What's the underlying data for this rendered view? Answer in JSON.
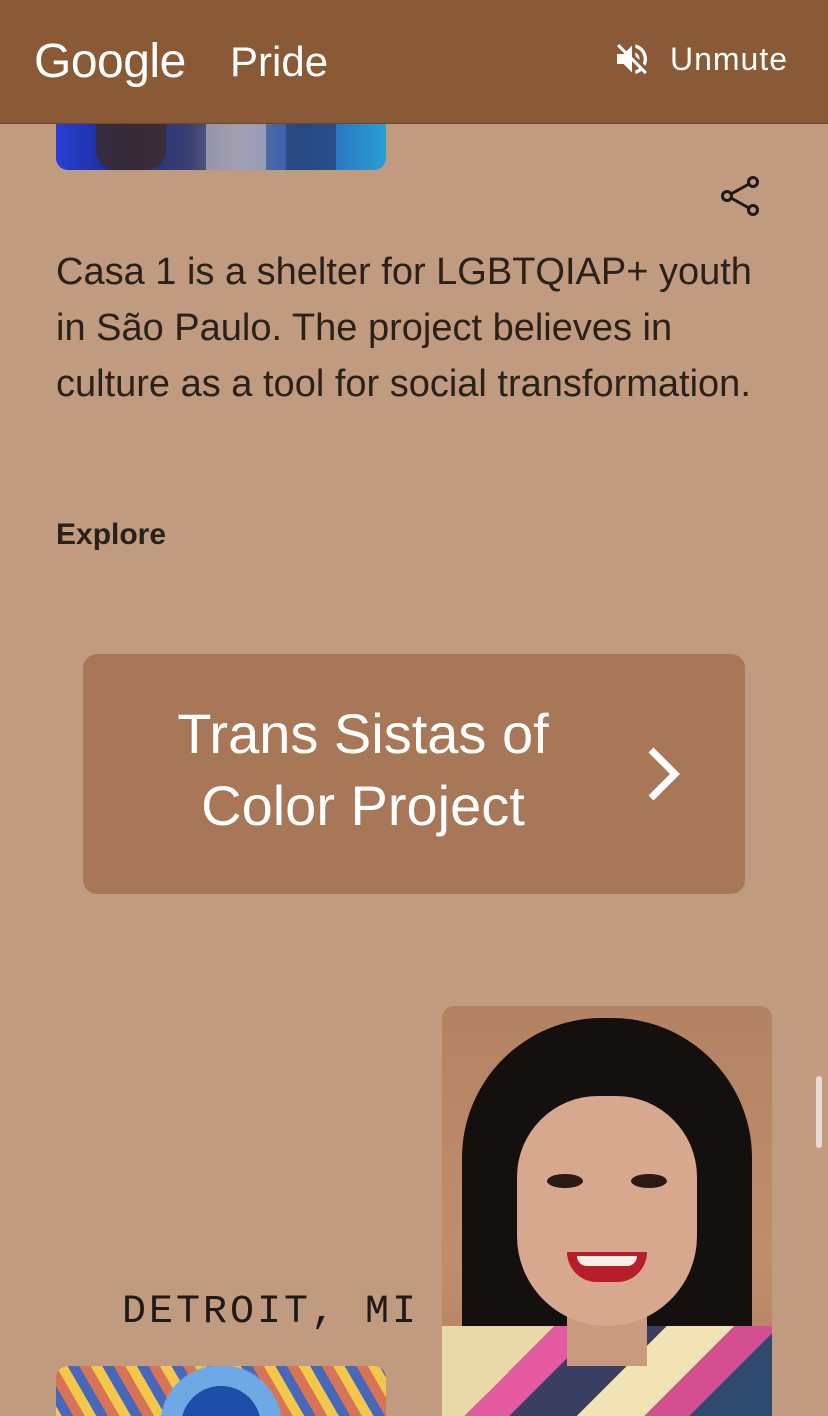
{
  "header": {
    "logo": "Google",
    "section": "Pride",
    "unmute_label": "Unmute",
    "unmute_icon": "volume-off-icon"
  },
  "main": {
    "share_icon": "share-icon",
    "description": "Casa 1 is a shelter for LGBTQIAP+ youth in São Paulo. The project believes in culture as a tool for social transformation.",
    "explore_label": "Explore",
    "card": {
      "title": "Trans Sistas of Color Project",
      "icon": "chevron-right-icon"
    },
    "location": "DETROIT, MI"
  },
  "colors": {
    "header_bg": "#8a5935",
    "page_bg": "#c09b80",
    "card_bg": "#a87757",
    "text": "#2a2119"
  }
}
